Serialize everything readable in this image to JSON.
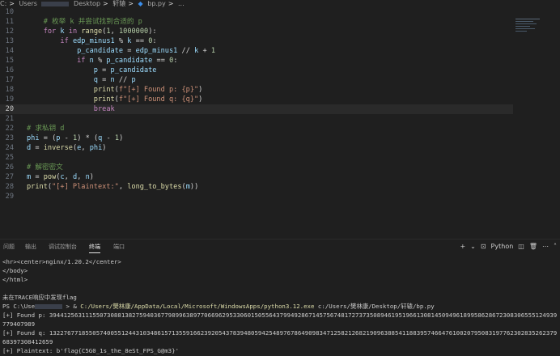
{
  "breadcrumb": {
    "seg1": "C:",
    "seg2": "Users",
    "seg3": "Desktop",
    "seg4": "轩辕",
    "file_icon": "python-file-icon",
    "file": "bp.py",
    "tail": "..."
  },
  "editor": {
    "lines": [
      {
        "n": "10",
        "code": ""
      },
      {
        "n": "11",
        "code": "    # 枚举 k 并尝试找到合适的 p"
      },
      {
        "n": "12",
        "code": "    for k in range(1, 1000000):"
      },
      {
        "n": "13",
        "code": "        if edp_minus1 % k == 0:"
      },
      {
        "n": "14",
        "code": "            p_candidate = edp_minus1 // k + 1"
      },
      {
        "n": "15",
        "code": "            if n % p_candidate == 0:"
      },
      {
        "n": "16",
        "code": "                p = p_candidate"
      },
      {
        "n": "17",
        "code": "                q = n // p"
      },
      {
        "n": "18",
        "code": "                print(f\"[+] Found p: {p}\")"
      },
      {
        "n": "19",
        "code": "                print(f\"[+] Found q: {q}\")"
      },
      {
        "n": "20",
        "code": "                break"
      },
      {
        "n": "21",
        "code": ""
      },
      {
        "n": "22",
        "code": "# 求私钥 d"
      },
      {
        "n": "23",
        "code": "phi = (p - 1) * (q - 1)"
      },
      {
        "n": "24",
        "code": "d = inverse(e, phi)"
      },
      {
        "n": "25",
        "code": ""
      },
      {
        "n": "26",
        "code": "# 解密密文"
      },
      {
        "n": "27",
        "code": "m = pow(c, d, n)"
      },
      {
        "n": "28",
        "code": "print(\"[+] Plaintext:\", long_to_bytes(m))"
      },
      {
        "n": "29",
        "code": ""
      }
    ],
    "active_line": "20"
  },
  "panel": {
    "tabs": [
      "问题",
      "输出",
      "调试控制台",
      "终端",
      "端口"
    ],
    "active_tab": "终端",
    "shell_name": "Python"
  },
  "terminal": {
    "l1": "<hr><center>nginx/1.20.2</center>",
    "l2": "</body>",
    "l3": "</html>",
    "l4": "",
    "l5": "未在TRACE响应中发现flag",
    "l6_prompt": "PS C:\\Use",
    "l6_rest": " > & ",
    "l6_exe": "C:/Users/樊林康/AppData/Local/Microsoft/WindowsApps/python3.12.exe",
    "l6_arg": " c:/Users/樊林康/Desktop/轩辕/bp.py",
    "l7": "[+] Found p: 39441256311155073088138275940367798996389770669629533060150556437994928671457567481727373508946195196613081450949618995862867230830655512493977940798​9",
    "l8": "[+] Found q: 1322767718550574005512443103486157135591662392054378394805942548976786490983471258212682190963885411883957466476100207950831977623028352623796839730841265​9",
    "l9": "[+] Plaintext: b'flag{C5G0_1s_the_8eSt_FPS_G@m3}'"
  }
}
